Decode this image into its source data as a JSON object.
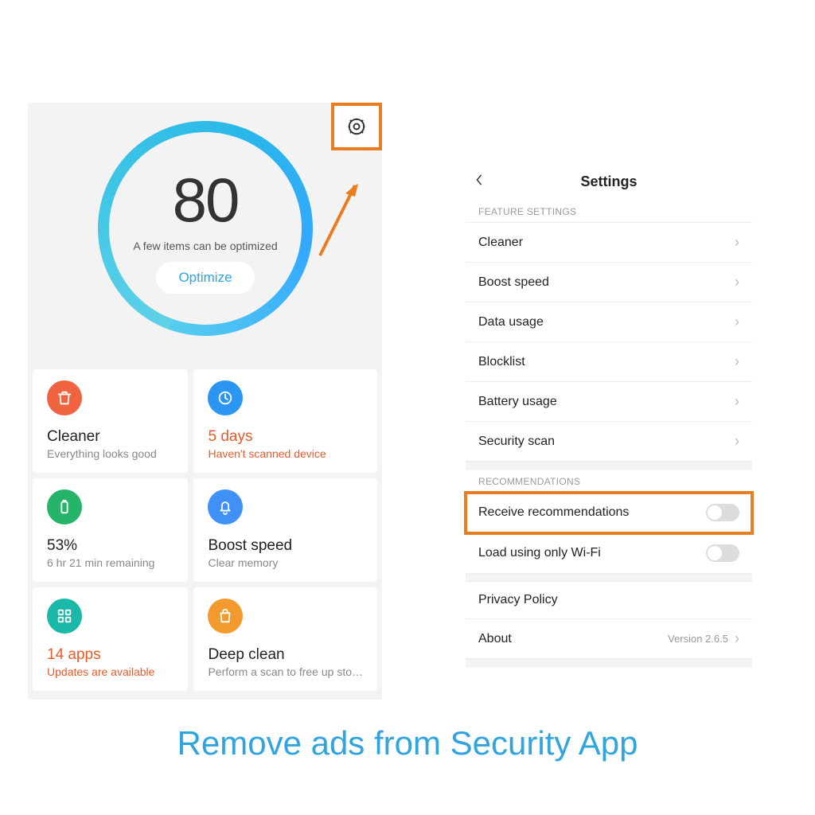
{
  "caption": "Remove ads from Security App",
  "security": {
    "score": "80",
    "score_caption": "A few items can be optimized",
    "optimize_label": "Optimize",
    "cards": [
      {
        "icon": "trash",
        "icon_bg": "#f0633f",
        "title": "Cleaner",
        "title_red": false,
        "sub": "Everything looks good",
        "sub_red": false
      },
      {
        "icon": "scan",
        "icon_bg": "#2a96f2",
        "title": "5 days",
        "title_red": true,
        "sub": "Haven't scanned device",
        "sub_red": true
      },
      {
        "icon": "battery",
        "icon_bg": "#26b36a",
        "title": "53%",
        "title_red": false,
        "sub": "6 hr 21 min  remaining",
        "sub_red": false
      },
      {
        "icon": "bell",
        "icon_bg": "#3f90f7",
        "title": "Boost speed",
        "title_red": false,
        "sub": "Clear memory",
        "sub_red": false
      },
      {
        "icon": "grid",
        "icon_bg": "#1ab8a8",
        "title": "14 apps",
        "title_red": true,
        "sub": "Updates are available",
        "sub_red": true
      },
      {
        "icon": "bag",
        "icon_bg": "#f39a2e",
        "title": "Deep clean",
        "title_red": false,
        "sub": "Perform a scan to free up sto…",
        "sub_red": false
      }
    ]
  },
  "settings": {
    "title": "Settings",
    "section_feature": "FEATURE SETTINGS",
    "feature_rows": [
      {
        "label": "Cleaner"
      },
      {
        "label": "Boost speed"
      },
      {
        "label": "Data usage"
      },
      {
        "label": "Blocklist"
      },
      {
        "label": "Battery usage"
      },
      {
        "label": "Security scan"
      }
    ],
    "section_reco": "RECOMMENDATIONS",
    "reco_rows": [
      {
        "label": "Receive recommendations",
        "highlight": true
      },
      {
        "label": "Load using only Wi-Fi",
        "highlight": false
      }
    ],
    "privacy_label": "Privacy Policy",
    "about_label": "About",
    "about_version": "Version 2.6.5"
  },
  "colors": {
    "highlight": "#ea7d1e",
    "caption": "#30a4de"
  }
}
